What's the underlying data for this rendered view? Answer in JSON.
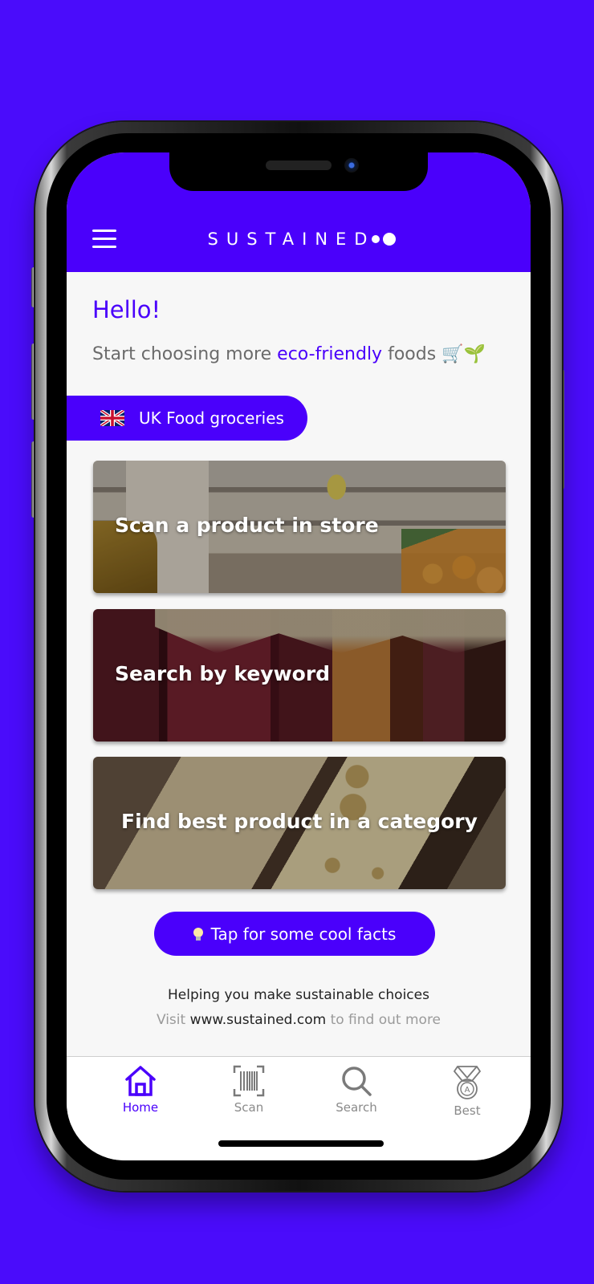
{
  "header": {
    "brand": "SUSTAINED",
    "menu_icon": "hamburger-menu-icon"
  },
  "main": {
    "greeting": "Hello!",
    "tagline_prefix": "Start choosing more ",
    "tagline_highlight": "eco-friendly",
    "tagline_suffix": " foods ",
    "tagline_emoji": "🛒🌱",
    "region": {
      "flag_icon": "uk-flag-icon",
      "label": "UK Food groceries"
    },
    "cards": [
      {
        "label": "Scan a product in store"
      },
      {
        "label": "Search by keyword"
      },
      {
        "label": "Find best product in a category"
      }
    ],
    "facts_button": {
      "icon": "lightbulb-icon",
      "label": "Tap for some cool facts"
    },
    "footer": {
      "helping": "Helping you make sustainable choices",
      "visit_prefix": "Visit ",
      "visit_link": "www.sustained.com",
      "visit_suffix": " to find out more"
    }
  },
  "bottom_nav": {
    "items": [
      {
        "label": "Home",
        "icon": "home-icon",
        "active": true
      },
      {
        "label": "Scan",
        "icon": "barcode-scan-icon",
        "active": false
      },
      {
        "label": "Search",
        "icon": "search-icon",
        "active": false
      },
      {
        "label": "Best",
        "icon": "medal-icon",
        "active": false
      }
    ]
  },
  "colors": {
    "brand": "#4a00fb",
    "background": "#4a0cfb",
    "screen_bg": "#f7f7f7",
    "inactive_nav": "#8a8a8a"
  }
}
